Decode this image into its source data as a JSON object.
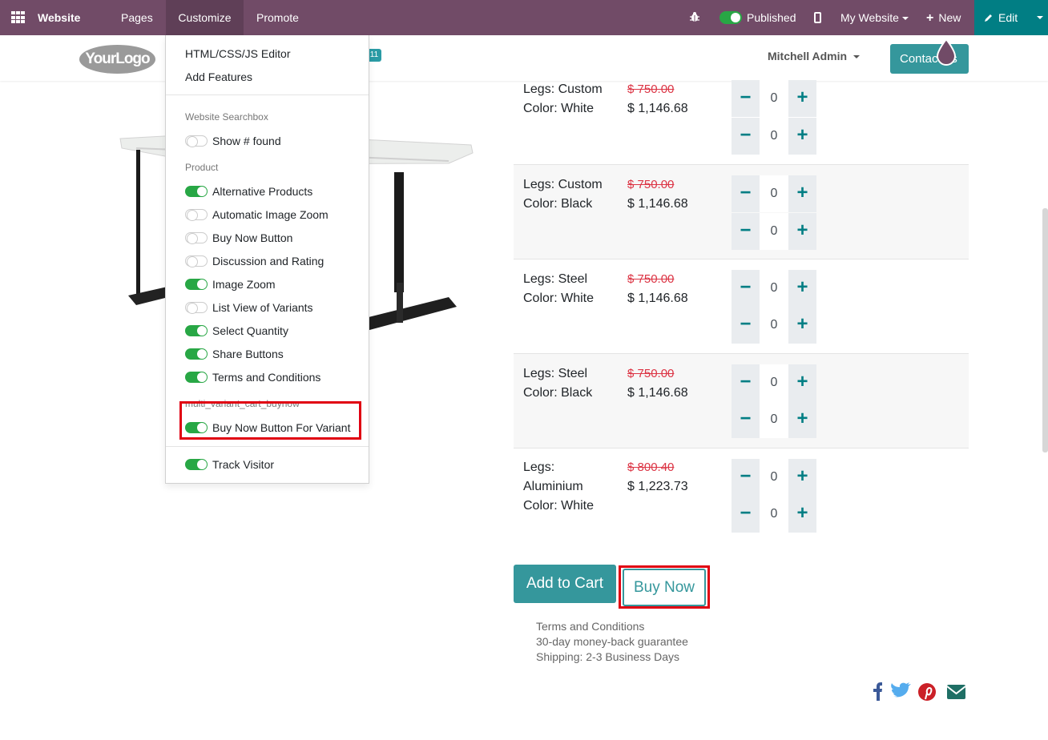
{
  "topbar": {
    "brand": "Website",
    "menu": [
      "Pages",
      "Customize",
      "Promote"
    ],
    "published_label": "Published",
    "my_website": "My Website",
    "new_label": "New",
    "edit_label": "Edit"
  },
  "header": {
    "logo_text": "YourLogo",
    "cart_count": "11",
    "user": "Mitchell Admin",
    "contact_label": "Contact us"
  },
  "customize_menu": {
    "items": [
      "HTML/CSS/JS Editor",
      "Add Features"
    ],
    "sections": {
      "searchbox": "Website Searchbox",
      "product": "Product",
      "module": "multi_variant_cart_buynow"
    },
    "options": [
      {
        "label": "Show # found",
        "on": false
      },
      {
        "label": "Alternative Products",
        "on": true
      },
      {
        "label": "Automatic Image Zoom",
        "on": false
      },
      {
        "label": "Buy Now Button",
        "on": false
      },
      {
        "label": "Discussion and Rating",
        "on": false
      },
      {
        "label": "Image Zoom",
        "on": true
      },
      {
        "label": "List View of Variants",
        "on": false
      },
      {
        "label": "Select Quantity",
        "on": true
      },
      {
        "label": "Share Buttons",
        "on": true
      },
      {
        "label": "Terms and Conditions",
        "on": true
      },
      {
        "label": "Buy Now Button For Variant",
        "on": true
      },
      {
        "label": "Track Visitor",
        "on": true
      }
    ]
  },
  "variants": [
    {
      "line1": "Legs: Custom",
      "line2": "Color: White",
      "old_price": "$ 750.00",
      "price": "$ 1,146.68",
      "qty1": "0",
      "qty2": "0"
    },
    {
      "line1": "Legs: Custom",
      "line2": "Color: Black",
      "old_price": "$ 750.00",
      "price": "$ 1,146.68",
      "qty1": "0",
      "qty2": "0"
    },
    {
      "line1": "Legs: Steel",
      "line2": "Color: White",
      "old_price": "$ 750.00",
      "price": "$ 1,146.68",
      "qty1": "0",
      "qty2": "0"
    },
    {
      "line1": "Legs: Steel",
      "line2": "Color: Black",
      "old_price": "$ 750.00",
      "price": "$ 1,146.68",
      "qty1": "0",
      "qty2": "0"
    },
    {
      "line1": "Legs:",
      "line2": "Aluminium",
      "line3": "Color: White",
      "old_price": "$ 800.40",
      "price": "$ 1,223.73",
      "qty1": "0",
      "qty2": "0"
    }
  ],
  "actions": {
    "add_to_cart": "Add to Cart",
    "buy_now": "Buy Now"
  },
  "info": [
    "Terms and Conditions",
    "30-day money-back guarantee",
    "Shipping: 2-3 Business Days"
  ],
  "social_icons": [
    "facebook-icon",
    "twitter-icon",
    "pinterest-icon",
    "email-icon"
  ],
  "colors": {
    "topbar": "#714B67",
    "accent": "#35979c",
    "highlight": "#e00012",
    "toggle_on": "#28a745",
    "strike": "#dc3545"
  }
}
